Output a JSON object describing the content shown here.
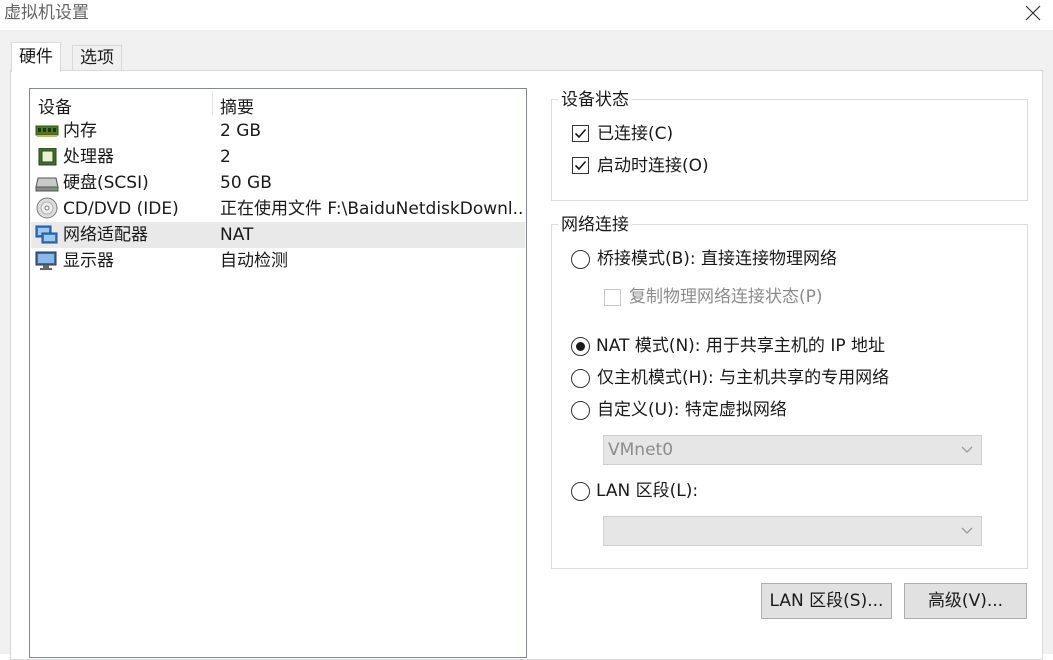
{
  "window": {
    "title": "虚拟机设置"
  },
  "tabs": [
    {
      "label": "硬件",
      "selected": true
    },
    {
      "label": "选项",
      "selected": false
    }
  ],
  "device_table": {
    "columns": [
      "设备",
      "摘要"
    ],
    "rows": [
      {
        "icon": "memory-icon",
        "device": "内存",
        "summary": "2 GB",
        "selected": false
      },
      {
        "icon": "processor-icon",
        "device": "处理器",
        "summary": "2",
        "selected": false
      },
      {
        "icon": "harddisk-icon",
        "device": "硬盘(SCSI)",
        "summary": "50 GB",
        "selected": false
      },
      {
        "icon": "cd-dvd-icon",
        "device": "CD/DVD (IDE)",
        "summary": "正在使用文件 F:\\BaiduNetdiskDownl...",
        "selected": false
      },
      {
        "icon": "network-adapter-icon",
        "device": "网络适配器",
        "summary": "NAT",
        "selected": true
      },
      {
        "icon": "display-icon",
        "device": "显示器",
        "summary": "自动检测",
        "selected": false
      }
    ]
  },
  "device_status": {
    "label": "设备状态",
    "connected": {
      "label": "已连接(C)",
      "checked": true
    },
    "connect_at_power_on": {
      "label": "启动时连接(O)",
      "checked": true
    }
  },
  "network": {
    "label": "网络连接",
    "bridged": {
      "label": "桥接模式(B): 直接连接物理网络",
      "selected": false
    },
    "replicate": {
      "label": "复制物理网络连接状态(P)",
      "checked": false,
      "disabled": true
    },
    "nat": {
      "label": "NAT 模式(N): 用于共享主机的 IP 地址",
      "selected": true
    },
    "host_only": {
      "label": "仅主机模式(H): 与主机共享的专用网络",
      "selected": false
    },
    "custom": {
      "label": "自定义(U): 特定虚拟网络",
      "selected": false
    },
    "custom_select": {
      "value": "VMnet0",
      "disabled": true
    },
    "lan_segment": {
      "label": "LAN 区段(L):",
      "selected": false
    },
    "lan_select": {
      "value": "",
      "disabled": true
    }
  },
  "buttons": {
    "lan_segments": "LAN 区段(S)...",
    "advanced": "高级(V)..."
  }
}
